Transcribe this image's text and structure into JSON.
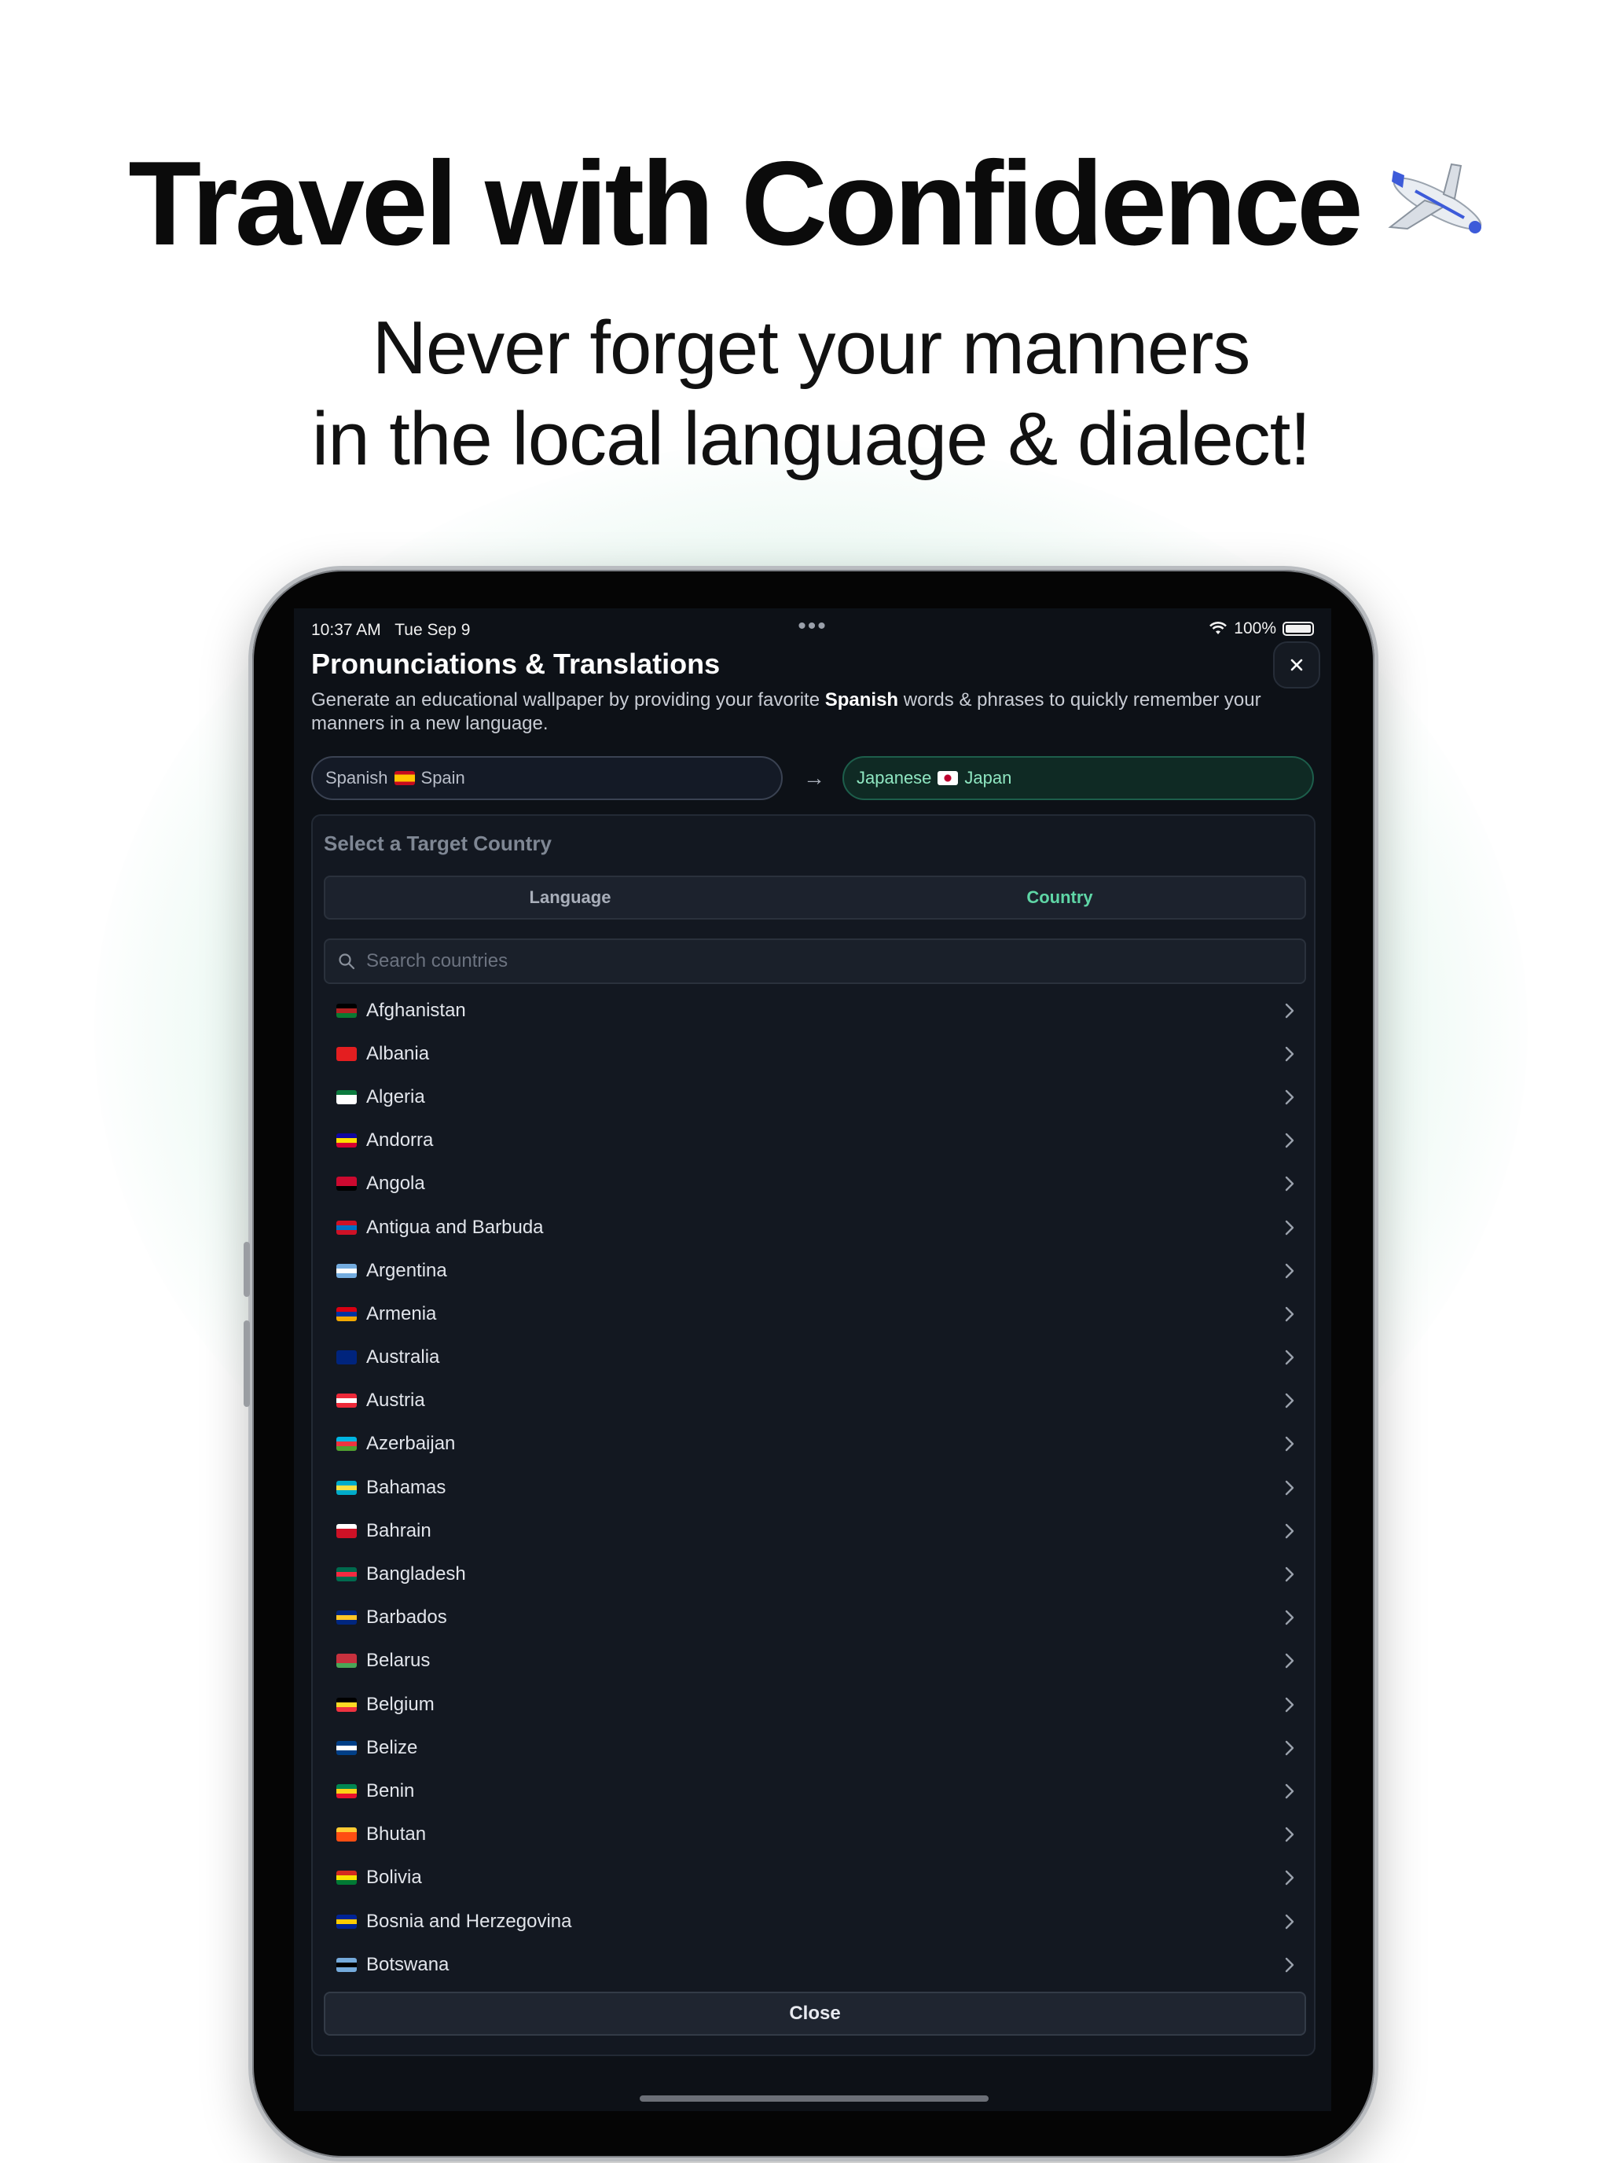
{
  "marketing": {
    "headline": "Travel with Confidence",
    "headline_icon": "airplane-emoji",
    "subhead_line1": "Never forget your manners",
    "subhead_line2": "in the local language & dialect!"
  },
  "status_bar": {
    "time": "10:37 AM",
    "date": "Tue Sep 9",
    "battery": "100%"
  },
  "sheet": {
    "title": "Pronunciations & Translations",
    "description_prefix": "Generate an educational wallpaper by providing your favorite ",
    "description_bold": "Spanish",
    "description_suffix": " words & phrases to quickly remember your manners in a new language.",
    "source_language": "Spanish",
    "source_country": "Spain",
    "target_language": "Japanese",
    "target_country": "Japan"
  },
  "picker": {
    "title": "Select a Target Country",
    "tabs": [
      "Language",
      "Country"
    ],
    "active_tab": "Country",
    "search_placeholder": "Search countries",
    "countries": [
      {
        "name": "Afghanistan",
        "flag": [
          "#000000",
          "#b22222",
          "#0a7a32"
        ]
      },
      {
        "name": "Albania",
        "flag": [
          "#e41e20",
          "#e41e20",
          "#e41e20"
        ]
      },
      {
        "name": "Algeria",
        "flag": [
          "#0b7a3e",
          "#ffffff",
          "#ffffff"
        ]
      },
      {
        "name": "Andorra",
        "flag": [
          "#10069f",
          "#fedd00",
          "#d50032"
        ]
      },
      {
        "name": "Angola",
        "flag": [
          "#cc092f",
          "#cc092f",
          "#000000"
        ]
      },
      {
        "name": "Antigua and Barbuda",
        "flag": [
          "#ce1126",
          "#0072c6",
          "#ce1126"
        ]
      },
      {
        "name": "Argentina",
        "flag": [
          "#74acdf",
          "#ffffff",
          "#74acdf"
        ]
      },
      {
        "name": "Armenia",
        "flag": [
          "#d90012",
          "#0033a0",
          "#f2a800"
        ]
      },
      {
        "name": "Australia",
        "flag": [
          "#00247d",
          "#00247d",
          "#00247d"
        ]
      },
      {
        "name": "Austria",
        "flag": [
          "#ed2939",
          "#ffffff",
          "#ed2939"
        ]
      },
      {
        "name": "Azerbaijan",
        "flag": [
          "#00b5e2",
          "#ef3340",
          "#509e2f"
        ]
      },
      {
        "name": "Bahamas",
        "flag": [
          "#00abc9",
          "#fae042",
          "#00abc9"
        ]
      },
      {
        "name": "Bahrain",
        "flag": [
          "#ffffff",
          "#ce1126",
          "#ce1126"
        ]
      },
      {
        "name": "Bangladesh",
        "flag": [
          "#006a4e",
          "#f42a41",
          "#006a4e"
        ]
      },
      {
        "name": "Barbados",
        "flag": [
          "#00267f",
          "#ffc726",
          "#00267f"
        ]
      },
      {
        "name": "Belarus",
        "flag": [
          "#c8313e",
          "#c8313e",
          "#4aa657"
        ]
      },
      {
        "name": "Belgium",
        "flag": [
          "#000000",
          "#fdda24",
          "#ef3340"
        ]
      },
      {
        "name": "Belize",
        "flag": [
          "#003f87",
          "#ffffff",
          "#003f87"
        ]
      },
      {
        "name": "Benin",
        "flag": [
          "#008751",
          "#fcd116",
          "#e8112d"
        ]
      },
      {
        "name": "Bhutan",
        "flag": [
          "#ffcc33",
          "#ff4e12",
          "#ff4e12"
        ]
      },
      {
        "name": "Bolivia",
        "flag": [
          "#d52b1e",
          "#f9e300",
          "#007934"
        ]
      },
      {
        "name": "Bosnia and Herzegovina",
        "flag": [
          "#002395",
          "#fecb00",
          "#002395"
        ]
      },
      {
        "name": "Botswana",
        "flag": [
          "#75aadb",
          "#000000",
          "#75aadb"
        ]
      }
    ],
    "close_label": "Close"
  },
  "colors": {
    "accent_green": "#5fd6a6",
    "screen_bg": "#0d1117"
  }
}
